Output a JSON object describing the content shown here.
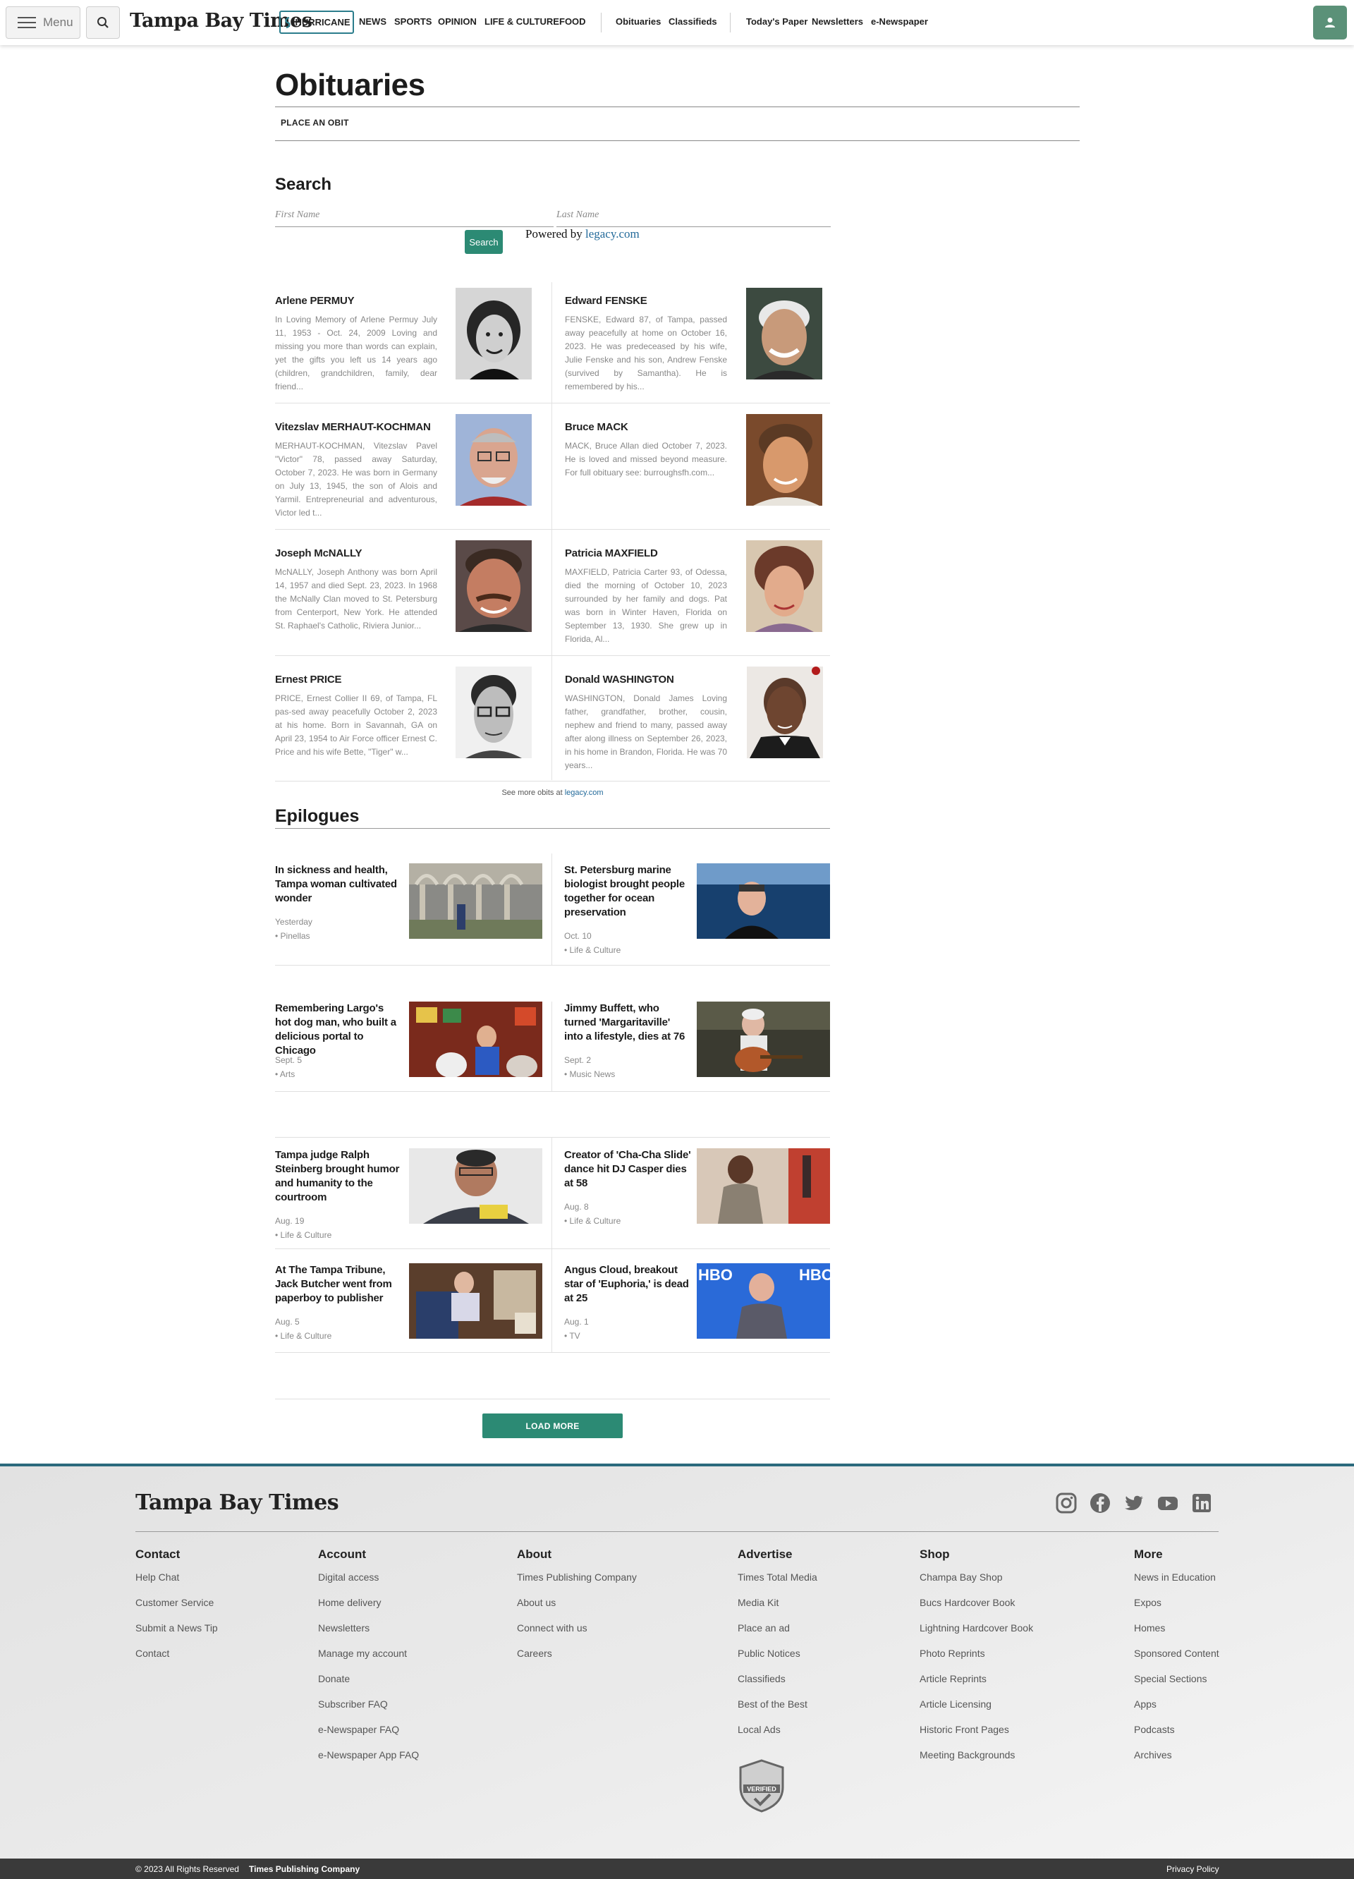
{
  "nav": {
    "menu_label": "Menu",
    "logo": "Tampa Bay Times",
    "hurricane": "HURRICANE",
    "links": [
      "NEWS",
      "SPORTS",
      "OPINION",
      "LIFE & CULTURE",
      "FOOD"
    ],
    "links2": [
      "Obituaries",
      "Classifieds"
    ],
    "links3": [
      "Today's Paper",
      "Newsletters",
      "e-Newspaper"
    ]
  },
  "header": {
    "title": "Obituaries",
    "place_obit": "PLACE AN OBIT"
  },
  "search": {
    "title": "Search",
    "first_placeholder": "First Name",
    "last_placeholder": "Last Name",
    "button": "Search",
    "powered_prefix": "Powered by ",
    "powered_link": "legacy.com"
  },
  "obits": [
    {
      "name": "Arlene PERMUY",
      "text": "In Loving Memory of Arlene Permuy July 11, 1953 - Oct. 24, 2009 Loving and missing you more than words can explain, yet the gifts you left us 14 years ago (children, grandchildren, family, dear friend..."
    },
    {
      "name": "Edward FENSKE",
      "text": "FENSKE, Edward 87, of Tampa, passed away peacefully at home on October 16, 2023. He was predeceased by his wife, Julie Fenske and his son, Andrew Fenske (survived by Samantha). He is remembered by his..."
    },
    {
      "name": "Vitezslav MERHAUT-KOCHMAN",
      "text": "MERHAUT-KOCHMAN, Vitezslav Pavel \"Victor\" 78, passed away Saturday, October 7, 2023. He was born in Germany on July 13, 1945, the son of Alois and Yarmil. Entrepreneurial and adventurous, Victor led t..."
    },
    {
      "name": "Bruce MACK",
      "text": "MACK, Bruce Allan died October 7, 2023. He is loved and missed beyond measure. For full obituary see: burroughsfh.com..."
    },
    {
      "name": "Joseph McNALLY",
      "text": "McNALLY, Joseph Anthony was born April 14, 1957 and died Sept. 23, 2023. In 1968 the McNally Clan moved to St. Petersburg from Centerport, New York. He attended St. Raphael's Catholic, Riviera Junior..."
    },
    {
      "name": "Patricia MAXFIELD",
      "text": "MAXFIELD, Patricia Carter 93, of Odessa, died the morning of October 10, 2023 surrounded by her family and dogs. Pat was born in Winter Haven, Florida on September 13, 1930. She grew up in Florida, Al..."
    },
    {
      "name": "Ernest PRICE",
      "text": "PRICE, Ernest Collier II 69, of Tampa, FL pas-sed away peacefully October 2, 2023 at his home. Born in Savannah, GA on April 23, 1954 to Air Force officer Ernest C. Price and his wife Bette, \"Tiger\" w..."
    },
    {
      "name": "Donald WASHINGTON",
      "text": "WASHINGTON, Donald James Loving father, grandfather, brother, cousin, nephew and friend to many, passed away after along illness on September 26, 2023, in his home in Brandon, Florida. He was 70 years..."
    }
  ],
  "more_obits": {
    "prefix": "See more obits at ",
    "link": "legacy.com"
  },
  "epilogues": {
    "title": "Epilogues",
    "stories": [
      {
        "headline": "In sickness and health, Tampa woman cultivated wonder",
        "date": "Yesterday",
        "category": "• Pinellas"
      },
      {
        "headline": "St. Petersburg marine biologist brought people together for ocean preservation",
        "date": "Oct. 10",
        "category": "• Life & Culture"
      },
      {
        "headline": "Remembering Largo's hot dog man, who built a delicious portal to Chicago",
        "date": "Sept. 5",
        "category": "• Arts"
      },
      {
        "headline": "Jimmy Buffett, who turned 'Margaritaville' into a lifestyle, dies at 76",
        "date": "Sept. 2",
        "category": "• Music News"
      },
      {
        "headline": "Tampa judge Ralph Steinberg brought humor and humanity to the courtroom",
        "date": "Aug. 19",
        "category": "• Life & Culture"
      },
      {
        "headline": "Creator of 'Cha-Cha Slide' dance hit DJ Casper dies at 58",
        "date": "Aug. 8",
        "category": "• Life & Culture"
      },
      {
        "headline": "At The Tampa Tribune, Jack Butcher went from paperboy to publisher",
        "date": "Aug. 5",
        "category": "• Life & Culture"
      },
      {
        "headline": "Angus Cloud, breakout star of 'Euphoria,' is dead at 25",
        "date": "Aug. 1",
        "category": "• TV"
      }
    ],
    "load_more": "LOAD MORE"
  },
  "footer": {
    "logo": "Tampa Bay Times",
    "columns": [
      {
        "title": "Contact",
        "items": [
          "Help Chat",
          "Customer Service",
          "Submit a News Tip",
          "Contact"
        ]
      },
      {
        "title": "Account",
        "items": [
          "Digital access",
          "Home delivery",
          "Newsletters",
          "Manage my account",
          "Donate",
          "Subscriber FAQ",
          "e-Newspaper FAQ",
          "e-Newspaper App FAQ"
        ]
      },
      {
        "title": "About",
        "items": [
          "Times Publishing Company",
          "About us",
          "Connect with us",
          "Careers"
        ]
      },
      {
        "title": "Advertise",
        "items": [
          "Times Total Media",
          "Media Kit",
          "Place an ad",
          "Public Notices",
          "Classifieds",
          "Best of the Best",
          "Local Ads"
        ]
      },
      {
        "title": "Shop",
        "items": [
          "Champa Bay Shop",
          "Bucs Hardcover Book",
          "Lightning Hardcover Book",
          "Photo Reprints",
          "Article Reprints",
          "Article Licensing",
          "Historic Front Pages",
          "Meeting Backgrounds"
        ]
      },
      {
        "title": "More",
        "items": [
          "News in Education",
          "Expos",
          "Homes",
          "Sponsored Content",
          "Special Sections",
          "Apps",
          "Podcasts",
          "Archives"
        ]
      }
    ],
    "badge_text": "VERIFIED",
    "copyright": "© 2023 All Rights Reserved",
    "company": "Times Publishing Company",
    "privacy": "Privacy Policy"
  },
  "colors": {
    "accent_green": "#2c8a74",
    "footer_border": "#2b6a7d",
    "link_blue": "#236a9a"
  }
}
